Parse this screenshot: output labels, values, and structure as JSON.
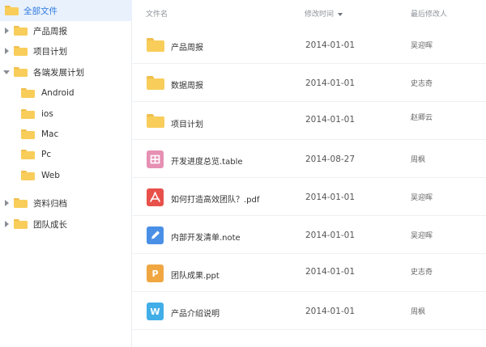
{
  "sidebar": {
    "items": [
      {
        "label": "全部文件",
        "level": 0,
        "caret": "none",
        "selected": true
      },
      {
        "label": "产品周报",
        "level": 1,
        "caret": "right",
        "selected": false
      },
      {
        "label": "项目计划",
        "level": 1,
        "caret": "right",
        "selected": false
      },
      {
        "label": "各端发展计划",
        "level": 1,
        "caret": "down",
        "selected": false
      },
      {
        "label": "Android",
        "level": 2,
        "caret": "none",
        "selected": false
      },
      {
        "label": "ios",
        "level": 2,
        "caret": "none",
        "selected": false
      },
      {
        "label": "Mac",
        "level": 2,
        "caret": "none",
        "selected": false
      },
      {
        "label": "Pc",
        "level": 2,
        "caret": "none",
        "selected": false
      },
      {
        "label": "Web",
        "level": 2,
        "caret": "none",
        "selected": false
      },
      {
        "label": "资料归档",
        "level": 1,
        "caret": "right",
        "selected": false
      },
      {
        "label": "团队成长",
        "level": 1,
        "caret": "right",
        "selected": false
      }
    ]
  },
  "table": {
    "columns": {
      "name": "文件名",
      "time": "修改时间",
      "user": "最后修改人"
    },
    "rows": [
      {
        "name": "产品周报",
        "time": "2014-01-01",
        "user": "吴迎晖",
        "type": "folder"
      },
      {
        "name": "数据周报",
        "time": "2014-01-01",
        "user": "史志奇",
        "type": "folder"
      },
      {
        "name": "项目计划",
        "time": "2014-01-01",
        "user": "赵卿云",
        "type": "folder"
      },
      {
        "name": "开发进度总览.table",
        "time": "2014-08-27",
        "user": "周枫",
        "type": "table"
      },
      {
        "name": "如何打造高效团队？.pdf",
        "time": "2014-01-01",
        "user": "吴迎晖",
        "type": "pdf"
      },
      {
        "name": "内部开发清单.note",
        "time": "2014-01-01",
        "user": "吴迎晖",
        "type": "note"
      },
      {
        "name": "团队成果.ppt",
        "time": "2014-01-01",
        "user": "史志奇",
        "type": "ppt"
      },
      {
        "name": "产品介绍说明",
        "time": "2014-01-01",
        "user": "周枫",
        "type": "word"
      }
    ]
  },
  "icons": {
    "folder": "folder-icon",
    "table": "table-file-icon",
    "pdf": "pdf-file-icon",
    "note": "note-file-icon",
    "ppt": "ppt-file-icon",
    "word": "word-file-icon",
    "sort": "sort-down-icon"
  },
  "colors": {
    "folder": "#f8cd5a",
    "table": "#e690b3",
    "pdf": "#e8504a",
    "note": "#4a8fe6",
    "ppt": "#f0a742",
    "word": "#42aee8",
    "selected_bg": "#e9f1fc",
    "selected_text": "#2f7be0"
  }
}
